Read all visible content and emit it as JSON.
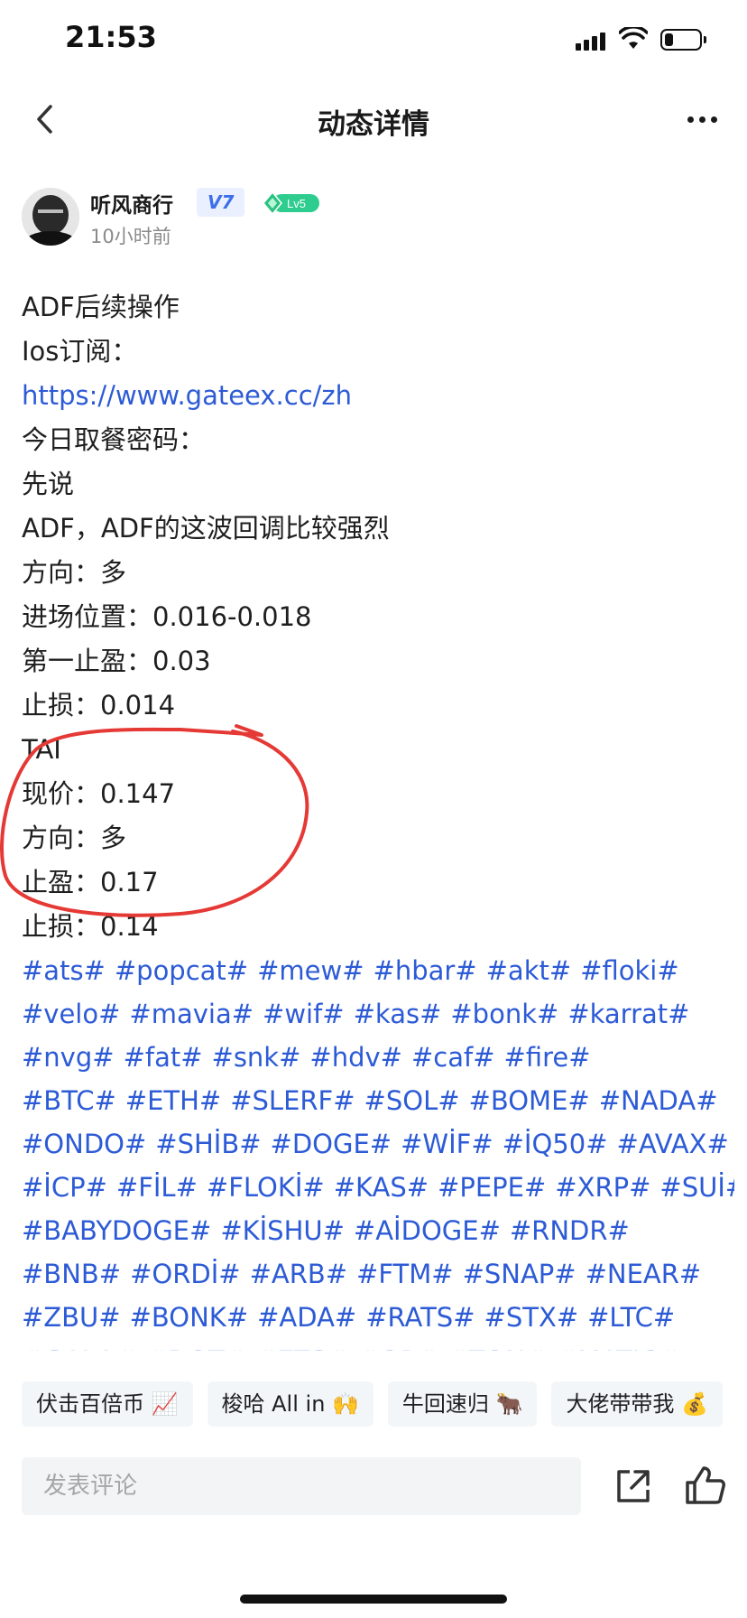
{
  "status_bar": {
    "time": "21:53",
    "battery_level": 0.25
  },
  "nav": {
    "title": "动态详情"
  },
  "author": {
    "name": "听风商行",
    "vip_badge": "V7",
    "level_badge": "Lv5",
    "post_time": "10小时前"
  },
  "post": {
    "lines": [
      "ADF后续操作",
      "Ios订阅：",
      "https://www.gateex.cc/zh",
      "今日取餐密码：",
      "先说",
      "ADF，ADF的这波回调比较强烈",
      "方向：多",
      "进场位置：0.016-0.018",
      "第一止盈：0.03",
      "止损：0.014",
      "TAI",
      "现价：0.147",
      "方向：多",
      "止盈：0.17",
      "止损：0.14"
    ],
    "link_index": 2,
    "tag_lines": [
      [
        "#ats#",
        "#popcat#",
        "#mew#",
        "#hbar#",
        "#akt#",
        "#floki#"
      ],
      [
        "#velo#",
        "#mavia#",
        "#wif#",
        "#kas#",
        "#bonk#",
        "#karrat#"
      ],
      [
        "#nvg#",
        "#fat#",
        "#snk#",
        "#hdv#",
        "#caf#",
        "#fire#"
      ],
      [
        "#BTC#",
        "#ETH#",
        "#SLERF#",
        "#SOL#",
        "#BOME#",
        "#NADA#"
      ],
      [
        "#ONDO#",
        "#SHİB#",
        "#DOGE#",
        "#WİF#",
        "#İQ50#",
        "#AVAX#"
      ],
      [
        "#İCP#",
        "#FİL#",
        "#FLOKİ#",
        "#KAS#",
        "#PEPE#",
        "#XRP#",
        "#SUİ#"
      ],
      [
        "#BABYDOGE#",
        "#KİSHU#",
        "#AİDOGE#",
        "#RNDR#"
      ],
      [
        "#BNB#",
        "#ORDİ#",
        "#ARB#",
        "#FTM#",
        "#SNAP#",
        "#NEAR#"
      ],
      [
        "#ZBU#",
        "#BONK#",
        "#ADA#",
        "#RATS#",
        "#STX#",
        "#LTC#"
      ],
      [
        "#GALA#",
        "#DOT#",
        "#ETC#",
        "#OP#",
        "#TON#",
        "#MATIC#"
      ]
    ]
  },
  "quick_replies": [
    "伏击百倍币 📈",
    "梭哈 All in 🙌",
    "牛回速归 🐂",
    "大佬带带我 💰"
  ],
  "comment_bar": {
    "placeholder": "发表评论"
  },
  "colors": {
    "link": "#2d5bd6",
    "annotation": "#e53935",
    "vip": "#3d6fe8",
    "level": "#2ecc8f"
  },
  "icons": [
    "back-arrow-icon",
    "more-icon",
    "share-icon",
    "thumbs-up-icon"
  ]
}
